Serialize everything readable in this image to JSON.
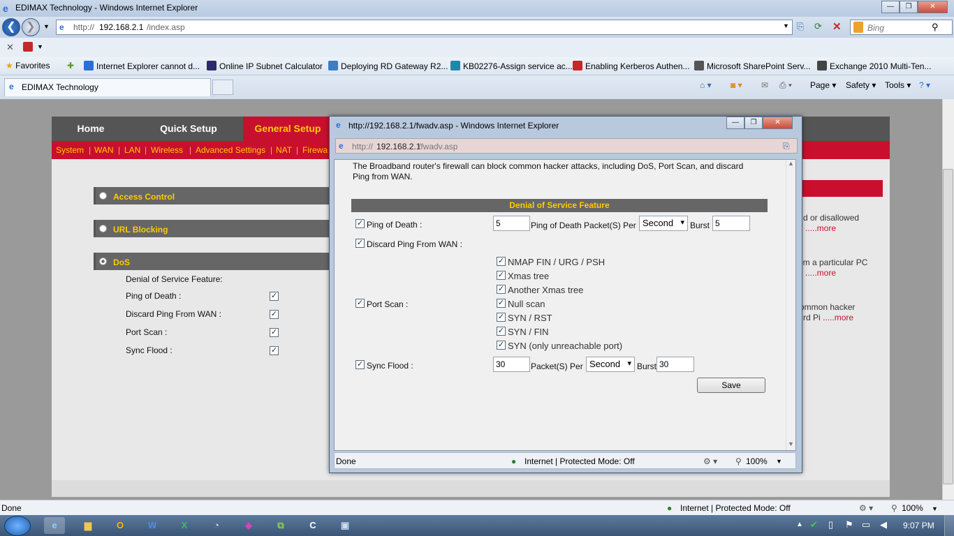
{
  "ie": {
    "title": "EDIMAX Technology - Windows Internet Explorer",
    "url_prefix": "http://",
    "url_host": "192.168.2.1",
    "url_path": "/index.asp",
    "search_placeholder": "Bing",
    "favorites_label": "Favorites",
    "favorites": [
      "Internet Explorer cannot d...",
      "Online IP Subnet Calculator",
      "Deploying RD Gateway R2...",
      "KB02276-Assign service ac...",
      "Enabling Kerberos Authen...",
      "Microsoft SharePoint Serv...",
      "Exchange 2010 Multi-Ten..."
    ],
    "tab_title": "EDIMAX Technology",
    "tools": {
      "page": "Page",
      "safety": "Safety",
      "tools": "Tools"
    },
    "status_done": "Done",
    "status_zone": "Internet | Protected Mode: Off",
    "zoom": "100%"
  },
  "site": {
    "tabs": [
      "Home",
      "Quick Setup",
      "General Setup"
    ],
    "submenu": [
      "System",
      "WAN",
      "LAN",
      "Wireless",
      "Advanced Settings",
      "NAT",
      "Firewa"
    ],
    "sections": [
      "Access Control",
      "URL Blocking",
      "DoS"
    ],
    "dos_title": "Denial of Service Feature:",
    "dos_items": [
      "Ping of Death :",
      "Discard Ping From WAN :",
      "Port Scan :",
      "Sync Flood :"
    ],
    "right_text": [
      {
        "text": "d or disallowed",
        "more": ".....more"
      },
      {
        "text": "om a particular PC",
        "more": ".....more"
      },
      {
        "text": "ommon hacker",
        "text2": "rd Pi",
        "more": ".....more"
      }
    ]
  },
  "popup": {
    "title": "http://192.168.2.1/fwadv.asp - Windows Internet Explorer",
    "url_prefix": "http://",
    "url_host": "192.168.2.1",
    "url_path": "/fwadv.asp",
    "intro_1": "The Broadband router's firewall can block common hacker attacks, including DoS, Port Scan, and discard",
    "intro_2": "Ping from WAN.",
    "header": "Denial of Service Feature",
    "ping_of_death": {
      "label": "Ping of Death :",
      "value": "5",
      "per_label": "Ping of Death Packet(S) Per",
      "unit": "Second",
      "burst_label": "Burst",
      "burst": "5"
    },
    "discard_ping": {
      "label": "Discard Ping From WAN :"
    },
    "port_scan": {
      "label": "Port Scan :",
      "options": [
        "NMAP FIN / URG / PSH",
        "Xmas tree",
        "Another Xmas tree",
        "Null scan",
        "SYN / RST",
        "SYN / FIN",
        "SYN (only unreachable port)"
      ]
    },
    "sync_flood": {
      "label": "Sync Flood :",
      "value": "30",
      "per_label": "Packet(S) Per",
      "unit": "Second",
      "burst_label": "Burst",
      "burst": "30"
    },
    "save_label": "Save",
    "status_done": "Done",
    "status_zone": "Internet | Protected Mode: Off",
    "zoom": "100%"
  },
  "taskbar": {
    "clock": "9:07 PM"
  }
}
